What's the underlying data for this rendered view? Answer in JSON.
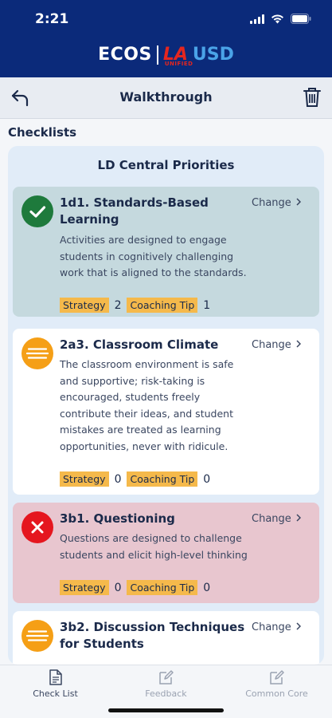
{
  "status_bar": {
    "time": "2:21"
  },
  "brand": {
    "left": "ECOS",
    "la": "LA",
    "usd": "USD",
    "unified": "UNIFIED"
  },
  "nav": {
    "title": "Walkthrough"
  },
  "section_label": "Checklists",
  "group": {
    "title": "LD Central Priorities",
    "change_label": "Change",
    "strategy_label": "Strategy",
    "tip_label": "Coaching Tip",
    "items": [
      {
        "title": "1d1. Standards-Based Learning",
        "description": "Activities are designed to engage students in cognitively challenging work that is aligned to the standards.",
        "status": "complete",
        "strategy_count": "2",
        "tip_count": "1"
      },
      {
        "title": "2a3. Classroom Climate",
        "description": "The classroom environment is safe and supportive; risk-taking is encouraged, students freely contribute their ideas, and student mistakes are treated as learning opportunities, never with ridicule.",
        "status": "in-progress",
        "strategy_count": "0",
        "tip_count": "0"
      },
      {
        "title": "3b1. Questioning",
        "description": "Questions are designed to challenge students and elicit high-level thinking",
        "status": "not-met",
        "strategy_count": "0",
        "tip_count": "0"
      },
      {
        "title": "3b2. Discussion Techniques for Students",
        "status": "in-progress"
      }
    ]
  },
  "tabs": [
    {
      "label": "Check List",
      "icon": "document-icon",
      "active": true
    },
    {
      "label": "Feedback",
      "icon": "edit-icon",
      "active": false
    },
    {
      "label": "Common Core",
      "icon": "edit-icon",
      "active": false
    }
  ],
  "colors": {
    "header": "#0b2a7a",
    "accent_tag": "#f5b94b",
    "complete": "#1e7a3c",
    "in_progress": "#f59f16",
    "not_met": "#e5161f"
  }
}
